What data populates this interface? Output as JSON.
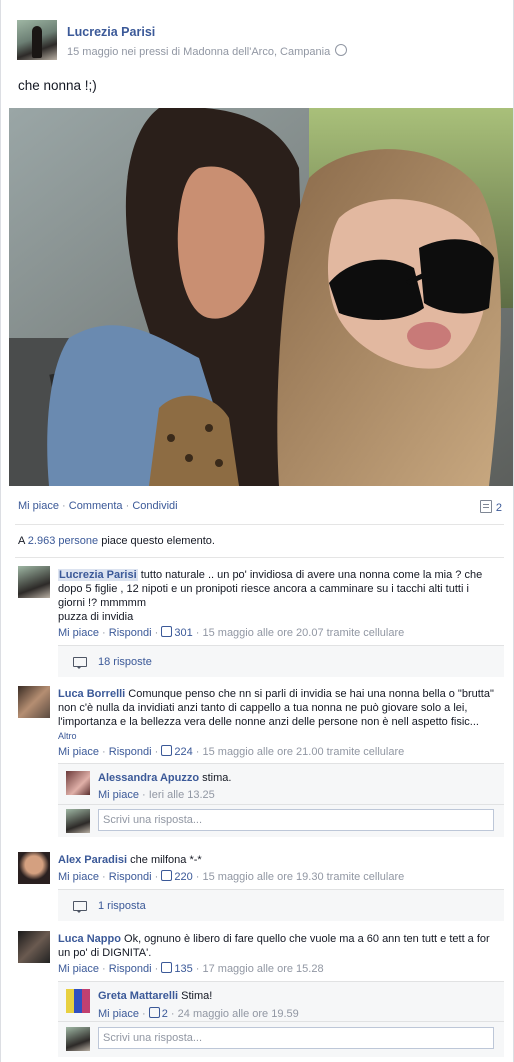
{
  "post": {
    "author": "Lucrezia Parisi",
    "meta": "15 maggio nei pressi di Madonna dell'Arco, Campania",
    "text": "che nonna !;)",
    "actions": [
      "Mi piace",
      "Commenta",
      "Condividi"
    ],
    "action_sep": " · ",
    "comment_count": "2",
    "likes_prefix": "A ",
    "likes_count": "2.963 persone",
    "likes_suffix": " piace questo elemento."
  },
  "common": {
    "like": "Mi piace",
    "reply": "Rispondi",
    "dot": " · ",
    "reply_placeholder": "Scrivi una risposta..."
  },
  "comments": [
    {
      "author": "Lucrezia Parisi",
      "text": " tutto naturale .. un po' invidiosa di avere una nonna come la mia ? che dopo 5 figlie , 12 nipoti e un pronipoti riesce ancora a camminare su i tacchi alti tutti i giorni !? mmmmm",
      "text2": "puzza di invidia",
      "likes": "301",
      "time": "15 maggio alle ore 20.07 tramite cellulare",
      "replies_label": "18 risposte"
    },
    {
      "author": "Luca Borrelli",
      "text": " Comunque penso che nn si parli di invidia se hai una nonna bella o \"brutta\" non c'è nulla da invidiati anzi tanto di cappello a tua nonna ne può giovare solo a lei, l'importanza e la bellezza vera delle nonne anzi delle persone non è nell aspetto fisic...",
      "more": " Altro",
      "likes": "224",
      "time": "15 maggio alle ore 21.00 tramite cellulare",
      "reply": {
        "author": "Alessandra Apuzzo",
        "text": " stima.",
        "time": "Ieri alle 13.25"
      }
    },
    {
      "author": "Alex Paradisi",
      "text": " che milfona *-*",
      "likes": "220",
      "time": "15 maggio alle ore 19.30 tramite cellulare",
      "replies_label": "1 risposta"
    },
    {
      "author": "Luca Nappo",
      "text": " Ok, ognuno è libero di fare quello che vuole ma a 60 ann ten tutt e tett a for un po' di DIGNITA'.",
      "likes": "135",
      "time": "17 maggio alle ore 15.28",
      "reply": {
        "author": "Greta Mattarelli",
        "text": " Stima!",
        "likes": "2",
        "time": "24 maggio alle ore 19.59"
      }
    }
  ],
  "colors": {
    "link": "#3b5998",
    "muted": "#9197a3",
    "box_bg": "#f6f7f8"
  }
}
